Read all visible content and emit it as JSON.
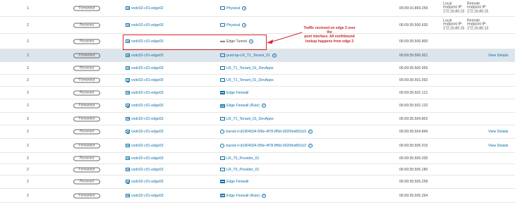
{
  "rows": [
    {
      "idx": "1",
      "badge": "Forwarded",
      "host": "vxdc02-c01-edge02",
      "comp": "Physical",
      "comp_icon": "physical-icon",
      "info": true,
      "time": "06:09:16.869.259",
      "local": [
        "Local",
        "endpoint IP:",
        "172.16.80.13"
      ],
      "remote": [
        "Remote",
        "endpoint IP:",
        "172.16.80.15"
      ]
    },
    {
      "idx": "2",
      "badge": "Received",
      "host": "vxdc02-c01-edge03",
      "comp": "Physical",
      "comp_icon": "physical-icon",
      "info": true,
      "time": "06:09:39.500.630",
      "local": [
        "Local",
        "endpoint IP:",
        "172.16.80.15"
      ],
      "remote": [
        "Remote",
        "endpoint IP:",
        "172.16.80.13"
      ]
    },
    {
      "idx": "2",
      "badge": "Received",
      "host": "vxdc02-c01-edge03",
      "comp": "Edge Tunnel",
      "comp_icon": "tunnel-icon",
      "info": true,
      "time": "06:09:39.500.800"
    },
    {
      "idx": "2",
      "badge": "Forwarded",
      "host": "vxdc02-c01-edge03",
      "comp": "punt-bp-LR_T1_Tenant_01",
      "comp_icon": "router-port-icon",
      "info": true,
      "time": "06:09:39.500.921",
      "view": "View Details",
      "highlight": true
    },
    {
      "idx": "2",
      "badge": "Received",
      "host": "vxdc02-c01-edge03",
      "comp": "LR_T1_Tenant_01_DevApps",
      "comp_icon": "router-port-icon",
      "time": "06:09:39.500.959"
    },
    {
      "idx": "2",
      "badge": "Forwarded",
      "host": "vxdc02-c01-edge03",
      "comp": "LR_T1_Tenant_01_DevApps",
      "comp_icon": "router-port-icon",
      "time": "06:09:39.501.092"
    },
    {
      "idx": "2",
      "badge": "Received",
      "host": "vxdc02-c01-edge03",
      "comp": "Edge Firewall",
      "comp_icon": "firewall-icon",
      "time": "06:09:39.502.121"
    },
    {
      "idx": "2",
      "badge": "Forwarded",
      "host": "vxdc02-c01-edge03",
      "comp": "Edge Firewall (Rule)",
      "comp_icon": "firewall-icon",
      "info": true,
      "time": "06:09:39.502.132"
    },
    {
      "idx": "2",
      "badge": "Forwarded",
      "host": "vxdc02-c01-edge03",
      "comp": "LR_T1_Tenant_01_DevApps",
      "comp_icon": "router-port-icon",
      "time": "06:09:39.504.802"
    },
    {
      "idx": "2",
      "badge": "Received",
      "host": "vxdc02-c01-edge03",
      "comp": "transit-rl-d1904934-5f9e-4f78-8f9d-0020fed651b3",
      "comp_icon": "router-icon",
      "info": true,
      "time": "06:09:39.504.849",
      "view": "View Details"
    },
    {
      "idx": "2",
      "badge": "Forwarded",
      "host": "vxdc02-c01-edge03",
      "comp": "transit-rl-d1904934-5f9e-4f78-8f9d-0020fed651b3",
      "comp_icon": "router-icon",
      "info": true,
      "time": "06:09:39.505.015",
      "view": "View Details"
    },
    {
      "idx": "2",
      "badge": "Received",
      "host": "vxdc02-c01-edge03",
      "comp": "LR_T0_Provider_01",
      "comp_icon": "router-port-icon",
      "time": "06:09:39.505.035"
    },
    {
      "idx": "2",
      "badge": "Forwarded",
      "host": "vxdc02-c01-edge03",
      "comp": "LR_T0_Provider_01",
      "comp_icon": "router-port-icon",
      "time": "06:09:39.505.180"
    },
    {
      "idx": "2",
      "badge": "Received",
      "host": "vxdc02-c01-edge03",
      "comp": "Edge Firewall",
      "comp_icon": "firewall-icon",
      "time": "06:09:39.505.258"
    },
    {
      "idx": "2",
      "badge": "Forwarded",
      "host": "vxdc02-c01-edge03",
      "comp": "Edge Firewall (Rule)",
      "comp_icon": "firewall-icon",
      "info": true,
      "time": "06:09:39.505.264"
    }
  ],
  "annotation": {
    "lines": [
      "Traffic recieved on edge 3 over the",
      "punt interface. All northbound",
      "lookup happens from edge 3"
    ],
    "color": "#c62828"
  },
  "colors": {
    "link": "#0a6fa8",
    "highlight_row": "#dde5ec",
    "annotation_box": "#d6272a"
  }
}
